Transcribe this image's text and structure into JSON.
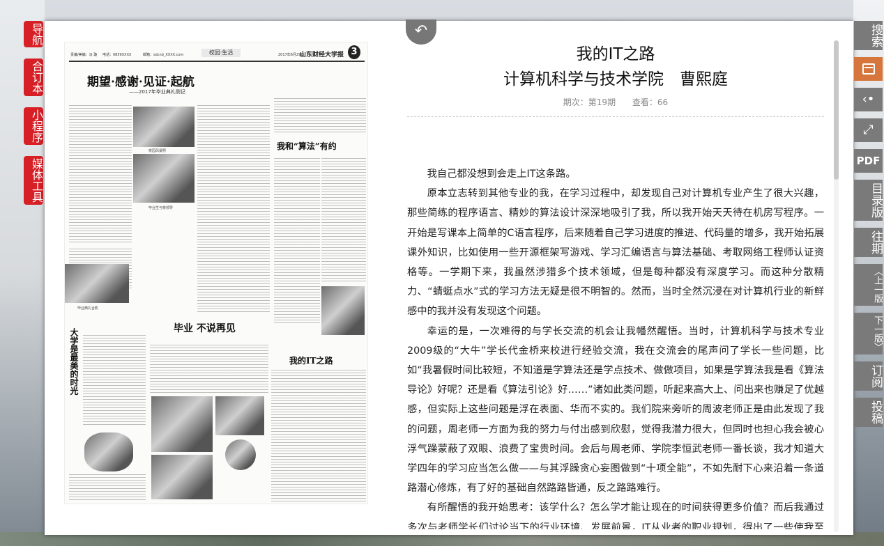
{
  "left_nav": [
    {
      "label": "导航"
    },
    {
      "label": "合订本"
    },
    {
      "label": "小程序"
    },
    {
      "label": "媒体工具"
    }
  ],
  "newspaper": {
    "header_left": "责编/美编：马 璇",
    "header_phone": "电话：0859XXXX",
    "header_mail": "邮箱：sdcnb_XXXX.com",
    "section": "校园·生活",
    "date": "2017年6月29日",
    "paper_name": "山东财经大学报",
    "page_number": "3",
    "title_main": "期望·感谢·见证·起航",
    "title_main_sub": "——2017年毕业典礼侧记",
    "title_right": "我和“算法”有约",
    "title_graduate": "毕业  不说再见",
    "title_vertical": "大学是最美的时光",
    "title_it": "我的IT之路",
    "caption_1": "校园风景照",
    "caption_2": "毕业生与校领导",
    "caption_3": "毕业典礼合影"
  },
  "article": {
    "title_line1": "我的IT之路",
    "title_line2": "计算机科学与技术学院　曹熙庭",
    "issue": "期次：第19期",
    "views": "查看：66",
    "paragraphs": [
      "我自己都没想到会走上IT这条路。",
      "原本立志转到其他专业的我，在学习过程中，却发现自己对计算机专业产生了很大兴趣，那些简练的程序语言、精妙的算法设计深深地吸引了我，所以我开始天天待在机房写程序。一开始是写课本上简单的C语言程序，后来随着自己学习进度的推进、代码量的增多，我开始拓展课外知识，比如使用一些开源框架写游戏、学习汇编语言与算法基础、考取网络工程师认证资格等。一学期下来，我虽然涉猎多个技术领域，但是每种都没有深度学习。而这种分散精力、“蜻蜓点水”式的学习方法无疑是很不明智的。然而，当时全然沉浸在对计算机行业的新鲜感中的我并没有发现这个问题。",
      "幸运的是，一次难得的与学长交流的机会让我幡然醒悟。当时，计算机科学与技术专业2009级的“大牛”学长代金桥来校进行经验交流，我在交流会的尾声问了学长一些问题，比如“我暑假时间比较短，不知道是学算法还是学点技术、做做项目，如果是学算法我是看《算法导论》好呢？还是看《算法引论》好……”诸如此类问题，听起来高大上、问出来也赚足了优越感，但实际上这些问题是浮在表面、华而不实的。我们院来旁听的周波老师正是由此发现了我的问题，周老师一方面为我的努力与付出感到欣慰，觉得我潜力很大，但同时也担心我会被心浮气躁蒙蔽了双眼、浪费了宝贵时间。会后与周老师、学院李恒武老师一番长谈，我才知道大学四年的学习应当怎么做——与其浮躁贪心妄图做到“十项全能”，不如先耐下心来沿着一条道路潜心修炼，有了好的基础自然路路皆通，反之路路难行。",
      "有所醒悟的我开始思考：该学什么？怎么学才能让现在的时间获得更多价值？而后我通过多次与老师学长们讨论当下的行业环境、发展前景，IT从业者的职业规划，得出了一些使我至今受"
    ]
  },
  "toolbar": {
    "search": "搜索",
    "calendar_icon": "calendar-icon",
    "share_icon": "share-icon",
    "fullscreen_icon": "fullscreen-icon",
    "pdf": "PDF",
    "catalog": "目录版",
    "past": "往期",
    "prev_page": "上一版",
    "next_page": "下一版",
    "subscribe": "订阅",
    "submit": "投稿"
  },
  "back_icon": "back-arrow-icon"
}
